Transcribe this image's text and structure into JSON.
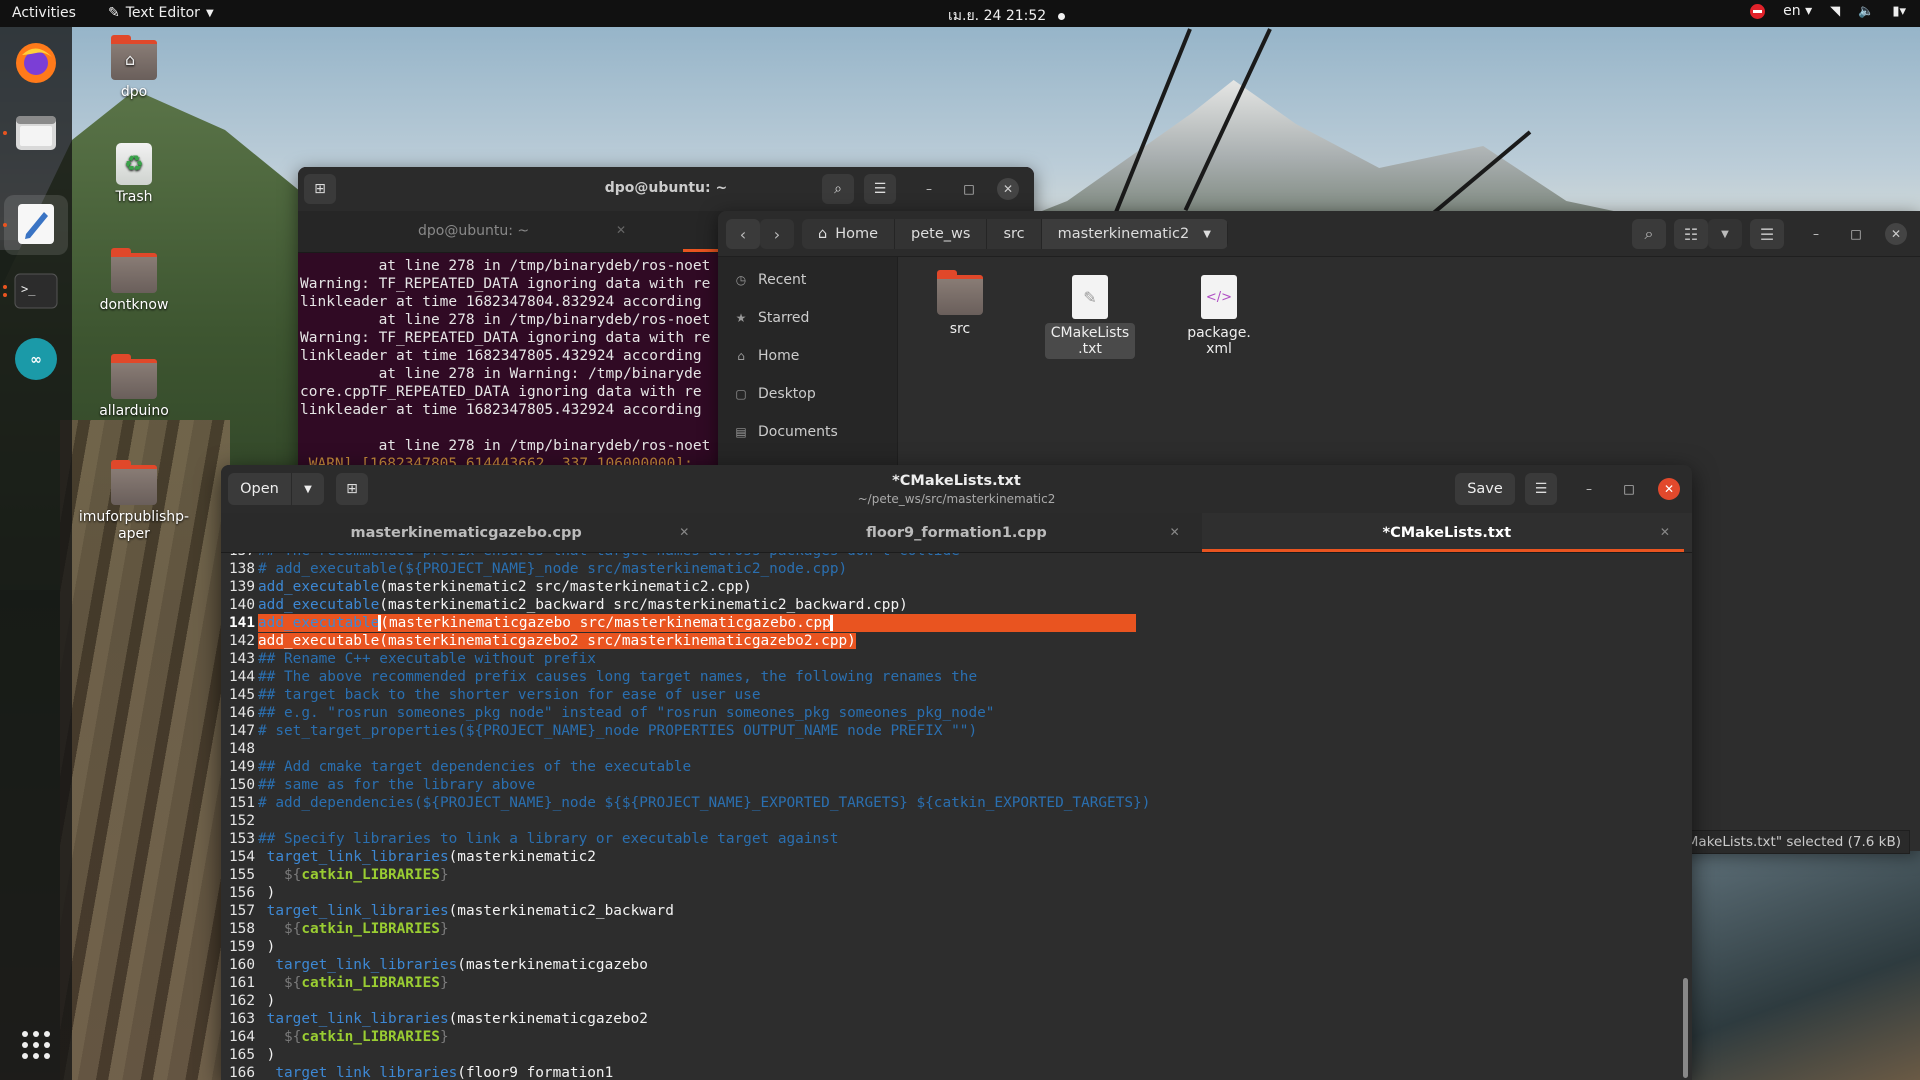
{
  "topbar": {
    "activities": "Activities",
    "app_name": "Text Editor",
    "clock": "เม.ย. 24  21:52",
    "language": "en"
  },
  "desktop_icons": [
    {
      "label": "dpo",
      "kind": "home-folder"
    },
    {
      "label": "Trash",
      "kind": "trash"
    },
    {
      "label": "dontknow",
      "kind": "folder"
    },
    {
      "label": "allarduino",
      "kind": "folder"
    },
    {
      "label": "imuforpublishp-aper",
      "kind": "folder"
    }
  ],
  "dock": [
    {
      "name": "firefox-icon"
    },
    {
      "name": "files-icon"
    },
    {
      "name": "text-editor-icon"
    },
    {
      "name": "terminal-icon"
    },
    {
      "name": "arduino-icon"
    },
    {
      "name": "show-apps-icon"
    }
  ],
  "terminal": {
    "title": "dpo@ubuntu: ~",
    "tab_label": "dpo@ubuntu: ~",
    "lines": [
      "         at line 278 in /tmp/binarydeb/ros-noet",
      "Warning: TF_REPEATED_DATA ignoring data with re",
      "linkleader at time 1682347804.832924 according",
      "         at line 278 in /tmp/binarydeb/ros-noet",
      "Warning: TF_REPEATED_DATA ignoring data with re",
      "linkleader at time 1682347805.432924 according",
      "         at line 278 in Warning: /tmp/binaryde",
      "core.cppTF_REPEATED_DATA ignoring data with re",
      "linkleader at time 1682347805.432924 according",
      "",
      "         at line 278 in /tmp/binarydeb/ros-noet"
    ],
    "last_line": " WARN] [1682347805.614443662, 337.106000000]: "
  },
  "files": {
    "breadcrumbs": [
      "Home",
      "pete_ws",
      "src",
      "masterkinematic2"
    ],
    "sidebar": [
      "Recent",
      "Starred",
      "Home",
      "Desktop",
      "Documents"
    ],
    "items": [
      {
        "name": "src",
        "type": "folder"
      },
      {
        "name": "CMakeLists\n.txt",
        "type": "text"
      },
      {
        "name": "package.\nxml",
        "type": "xml"
      }
    ],
    "status": "MakeLists.txt\" selected (7.6 kB)"
  },
  "editor": {
    "open_label": "Open",
    "title": "*CMakeLists.txt",
    "subtitle": "~/pete_ws/src/masterkinematic2",
    "save_label": "Save",
    "tabs": [
      {
        "label": "masterkinematicgazebo.cpp",
        "active": false
      },
      {
        "label": "floor9_formation1.cpp",
        "active": false
      },
      {
        "label": "*CMakeLists.txt",
        "active": true
      }
    ],
    "lines": [
      {
        "n": "137",
        "text": "## The recommended prefix ensures that target names across packages don't collide"
      },
      {
        "n": "138",
        "text": "# add_executable(${PROJECT_NAME}_node src/masterkinematic2_node.cpp)"
      },
      {
        "n": "139",
        "text": "add_executable(masterkinematic2 src/masterkinematic2.cpp)"
      },
      {
        "n": "140",
        "text": "add_executable(masterkinematic2_backward src/masterkinematic2_backward.cpp)"
      },
      {
        "n": "141",
        "text": "add_executable(masterkinematicgazebo src/masterkinematicgazebo.cpp)"
      },
      {
        "n": "142",
        "text": "add_executable(masterkinematicgazebo2 src/masterkinematicgazebo2.cpp)"
      },
      {
        "n": "143",
        "text": "## Rename C++ executable without prefix"
      },
      {
        "n": "144",
        "text": "## The above recommended prefix causes long target names, the following renames the"
      },
      {
        "n": "145",
        "text": "## target back to the shorter version for ease of user use"
      },
      {
        "n": "146",
        "text": "## e.g. \"rosrun someones_pkg node\" instead of \"rosrun someones_pkg someones_pkg_node\""
      },
      {
        "n": "147",
        "text": "# set_target_properties(${PROJECT_NAME}_node PROPERTIES OUTPUT_NAME node PREFIX \"\")"
      },
      {
        "n": "148",
        "text": ""
      },
      {
        "n": "149",
        "text": "## Add cmake target dependencies of the executable"
      },
      {
        "n": "150",
        "text": "## same as for the library above"
      },
      {
        "n": "151",
        "text": "# add_dependencies(${PROJECT_NAME}_node ${${PROJECT_NAME}_EXPORTED_TARGETS} ${catkin_EXPORTED_TARGETS})"
      },
      {
        "n": "152",
        "text": ""
      },
      {
        "n": "153",
        "text": "## Specify libraries to link a library or executable target against"
      },
      {
        "n": "154",
        "text": " target_link_libraries(masterkinematic2"
      },
      {
        "n": "155",
        "text": "   ${catkin_LIBRARIES}"
      },
      {
        "n": "156",
        "text": " )"
      },
      {
        "n": "157",
        "text": " target_link_libraries(masterkinematic2_backward"
      },
      {
        "n": "158",
        "text": "   ${catkin_LIBRARIES}"
      },
      {
        "n": "159",
        "text": " )"
      },
      {
        "n": "160",
        "text": "  target_link_libraries(masterkinematicgazebo"
      },
      {
        "n": "161",
        "text": "   ${catkin_LIBRARIES}"
      },
      {
        "n": "162",
        "text": " )"
      },
      {
        "n": "163",
        "text": " target_link_libraries(masterkinematicgazebo2"
      },
      {
        "n": "164",
        "text": "   ${catkin_LIBRARIES}"
      },
      {
        "n": "165",
        "text": " )"
      },
      {
        "n": "166",
        "text": "  target_link_libraries(floor9_formation1"
      }
    ]
  }
}
